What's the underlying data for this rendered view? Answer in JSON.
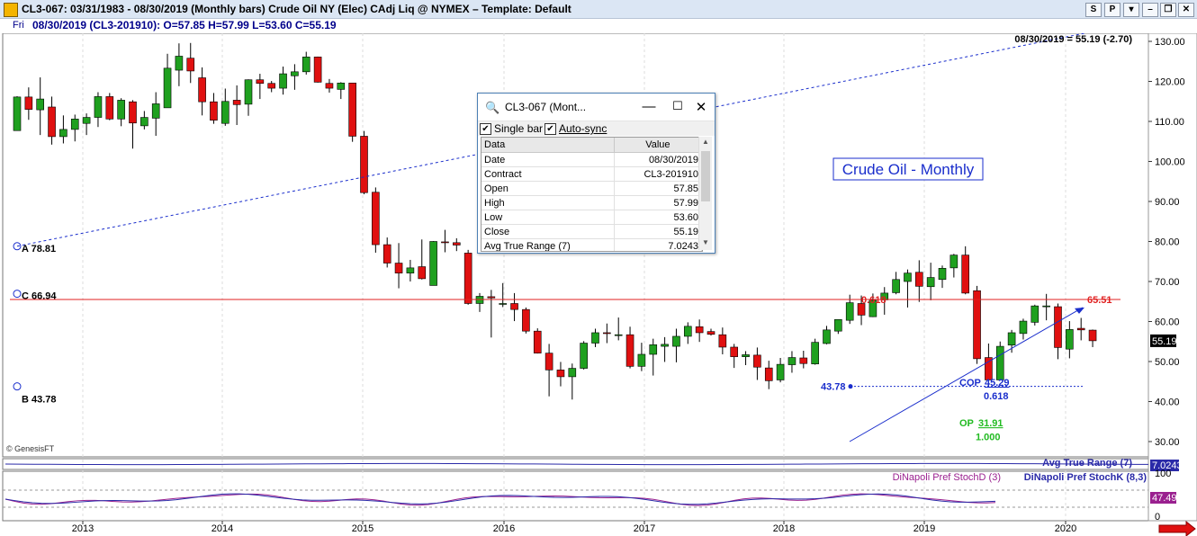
{
  "window": {
    "title": "CL3-067:  03/31/1983 - 08/30/2019  (Monthly bars)   Crude Oil NY (Elec) CAdj Liq @ NYMEX  –  Template: Default",
    "buttons": [
      "S",
      "P",
      "▾",
      "–",
      "❐",
      "✕"
    ]
  },
  "info": {
    "day": "Fri",
    "ohlc": "08/30/2019 (CL3-201910):  O=57.85  H=57.99  L=53.60  C=55.19"
  },
  "chart_data": {
    "type": "candlestick",
    "title": "Crude Oil - Monthly",
    "corner_note": "08/30/2019 = 55.19 (-2.70)",
    "copyright": "© GenesisFT",
    "yaxis": {
      "ticks": [
        "130.00",
        "120.00",
        "110.00",
        "100.00",
        "90.00",
        "80.00",
        "70.00",
        "60.00",
        "50.00",
        "40.00",
        "30.00"
      ],
      "ylim": [
        27,
        132
      ]
    },
    "xaxis": {
      "ticks": [
        "2013",
        "2014",
        "2015",
        "2016",
        "2017",
        "2018",
        "2019",
        "2020"
      ]
    },
    "last_price": "55.19",
    "bars": [
      {
        "o": 107.7,
        "h": 116.3,
        "l": 108.1,
        "c": 116.1
      },
      {
        "o": 116.1,
        "h": 118.5,
        "l": 110.4,
        "c": 113.0
      },
      {
        "o": 112.9,
        "h": 121.0,
        "l": 106.6,
        "c": 115.6
      },
      {
        "o": 113.6,
        "h": 116.2,
        "l": 104.2,
        "c": 106.2
      },
      {
        "o": 106.2,
        "h": 111.5,
        "l": 104.5,
        "c": 108.0
      },
      {
        "o": 108.0,
        "h": 111.7,
        "l": 105.0,
        "c": 110.6
      },
      {
        "o": 109.5,
        "h": 112.0,
        "l": 106.6,
        "c": 111.0
      },
      {
        "o": 111.0,
        "h": 117.3,
        "l": 108.6,
        "c": 116.2
      },
      {
        "o": 116.2,
        "h": 117.1,
        "l": 110.3,
        "c": 110.6
      },
      {
        "o": 110.6,
        "h": 115.8,
        "l": 108.8,
        "c": 115.3
      },
      {
        "o": 114.9,
        "h": 115.3,
        "l": 103.2,
        "c": 109.6
      },
      {
        "o": 108.9,
        "h": 112.6,
        "l": 108.0,
        "c": 111.0
      },
      {
        "o": 110.8,
        "h": 117.3,
        "l": 106.4,
        "c": 114.4
      },
      {
        "o": 113.4,
        "h": 126.9,
        "l": 113.4,
        "c": 123.3
      },
      {
        "o": 122.8,
        "h": 129.5,
        "l": 118.8,
        "c": 126.3
      },
      {
        "o": 125.8,
        "h": 129.6,
        "l": 119.6,
        "c": 122.6
      },
      {
        "o": 120.9,
        "h": 123.5,
        "l": 111.5,
        "c": 114.9
      },
      {
        "o": 114.9,
        "h": 117.1,
        "l": 109.4,
        "c": 110.3
      },
      {
        "o": 109.5,
        "h": 118.2,
        "l": 108.9,
        "c": 115.0
      },
      {
        "o": 115.3,
        "h": 119.0,
        "l": 109.1,
        "c": 114.2
      },
      {
        "o": 114.3,
        "h": 120.5,
        "l": 111.4,
        "c": 120.4
      },
      {
        "o": 120.4,
        "h": 121.9,
        "l": 115.6,
        "c": 119.5
      },
      {
        "o": 119.5,
        "h": 120.1,
        "l": 117.3,
        "c": 118.3
      },
      {
        "o": 118.3,
        "h": 123.7,
        "l": 116.7,
        "c": 121.9
      },
      {
        "o": 121.4,
        "h": 124.3,
        "l": 117.9,
        "c": 122.4
      },
      {
        "o": 122.4,
        "h": 127.4,
        "l": 121.7,
        "c": 126.1
      },
      {
        "o": 126.1,
        "h": 126.2,
        "l": 119.7,
        "c": 119.8
      },
      {
        "o": 119.5,
        "h": 120.6,
        "l": 117.2,
        "c": 118.3
      },
      {
        "o": 118.0,
        "h": 119.8,
        "l": 115.6,
        "c": 119.6
      },
      {
        "o": 119.6,
        "h": 119.6,
        "l": 104.9,
        "c": 106.3
      },
      {
        "o": 106.3,
        "h": 107.6,
        "l": 91.8,
        "c": 92.2
      },
      {
        "o": 92.3,
        "h": 93.5,
        "l": 77.2,
        "c": 79.2
      },
      {
        "o": 79.2,
        "h": 81.0,
        "l": 73.5,
        "c": 74.6
      },
      {
        "o": 74.6,
        "h": 79.6,
        "l": 68.3,
        "c": 72.1
      },
      {
        "o": 72.1,
        "h": 75.4,
        "l": 70.0,
        "c": 73.4
      },
      {
        "o": 73.7,
        "h": 80.5,
        "l": 70.5,
        "c": 70.7
      },
      {
        "o": 69.0,
        "h": 80.1,
        "l": 69.4,
        "c": 80.0
      },
      {
        "o": 79.9,
        "h": 82.9,
        "l": 77.3,
        "c": 79.7
      },
      {
        "o": 79.7,
        "h": 80.8,
        "l": 77.6,
        "c": 79.1
      },
      {
        "o": 77.1,
        "h": 77.9,
        "l": 64.2,
        "c": 64.5
      },
      {
        "o": 64.5,
        "h": 67.1,
        "l": 62.4,
        "c": 66.3
      },
      {
        "o": 66.2,
        "h": 67.9,
        "l": 56.0,
        "c": 65.9
      },
      {
        "o": 64.3,
        "h": 69.6,
        "l": 63.6,
        "c": 64.5
      },
      {
        "o": 64.5,
        "h": 67.1,
        "l": 60.1,
        "c": 63.0
      },
      {
        "o": 63.0,
        "h": 63.5,
        "l": 57.0,
        "c": 57.6
      },
      {
        "o": 57.6,
        "h": 58.3,
        "l": 52.0,
        "c": 52.1
      },
      {
        "o": 52.1,
        "h": 54.4,
        "l": 41.3,
        "c": 47.9
      },
      {
        "o": 47.9,
        "h": 49.9,
        "l": 43.8,
        "c": 46.2
      },
      {
        "o": 46.2,
        "h": 49.5,
        "l": 40.5,
        "c": 48.3
      },
      {
        "o": 48.3,
        "h": 55.1,
        "l": 48.0,
        "c": 54.6
      },
      {
        "o": 54.6,
        "h": 58.2,
        "l": 53.6,
        "c": 57.2
      },
      {
        "o": 57.2,
        "h": 59.5,
        "l": 54.6,
        "c": 57.0
      },
      {
        "o": 56.6,
        "h": 61.0,
        "l": 55.3,
        "c": 56.7
      },
      {
        "o": 56.7,
        "h": 58.7,
        "l": 48.3,
        "c": 48.8
      },
      {
        "o": 48.8,
        "h": 54.7,
        "l": 47.6,
        "c": 51.8
      },
      {
        "o": 51.8,
        "h": 55.7,
        "l": 46.5,
        "c": 54.2
      },
      {
        "o": 53.8,
        "h": 56.1,
        "l": 49.9,
        "c": 54.3
      },
      {
        "o": 53.8,
        "h": 58.2,
        "l": 49.8,
        "c": 56.3
      },
      {
        "o": 56.3,
        "h": 59.8,
        "l": 54.4,
        "c": 58.8
      },
      {
        "o": 58.7,
        "h": 60.5,
        "l": 54.9,
        "c": 57.2
      },
      {
        "o": 57.5,
        "h": 58.2,
        "l": 56.5,
        "c": 56.8
      },
      {
        "o": 56.7,
        "h": 58.5,
        "l": 51.8,
        "c": 53.6
      },
      {
        "o": 53.6,
        "h": 54.4,
        "l": 48.4,
        "c": 51.2
      },
      {
        "o": 51.2,
        "h": 52.6,
        "l": 49.1,
        "c": 51.7
      },
      {
        "o": 51.6,
        "h": 53.5,
        "l": 45.4,
        "c": 48.6
      },
      {
        "o": 48.4,
        "h": 50.2,
        "l": 43.1,
        "c": 45.2
      },
      {
        "o": 45.4,
        "h": 50.9,
        "l": 44.8,
        "c": 49.3
      },
      {
        "o": 49.2,
        "h": 52.6,
        "l": 47.2,
        "c": 51.0
      },
      {
        "o": 50.9,
        "h": 52.7,
        "l": 48.3,
        "c": 49.5
      },
      {
        "o": 49.4,
        "h": 55.7,
        "l": 49.2,
        "c": 54.8
      },
      {
        "o": 54.5,
        "h": 58.9,
        "l": 54.3,
        "c": 57.9
      },
      {
        "o": 57.6,
        "h": 60.4,
        "l": 56.9,
        "c": 60.5
      },
      {
        "o": 60.3,
        "h": 66.7,
        "l": 59.4,
        "c": 64.7
      },
      {
        "o": 64.5,
        "h": 66.5,
        "l": 59.1,
        "c": 61.6
      },
      {
        "o": 61.2,
        "h": 67.0,
        "l": 61.1,
        "c": 65.3
      },
      {
        "o": 65.4,
        "h": 68.6,
        "l": 61.7,
        "c": 67.1
      },
      {
        "o": 67.2,
        "h": 72.4,
        "l": 66.8,
        "c": 70.5
      },
      {
        "o": 70.0,
        "h": 73.0,
        "l": 63.5,
        "c": 72.1
      },
      {
        "o": 72.3,
        "h": 75.3,
        "l": 64.9,
        "c": 68.8
      },
      {
        "o": 68.7,
        "h": 74.7,
        "l": 65.3,
        "c": 71.0
      },
      {
        "o": 70.5,
        "h": 74.0,
        "l": 68.4,
        "c": 73.3
      },
      {
        "o": 73.4,
        "h": 76.9,
        "l": 71.0,
        "c": 76.6
      },
      {
        "o": 76.6,
        "h": 78.8,
        "l": 66.8,
        "c": 67.1
      },
      {
        "o": 67.7,
        "h": 68.9,
        "l": 49.4,
        "c": 50.7
      },
      {
        "o": 51.0,
        "h": 54.5,
        "l": 43.8,
        "c": 45.4
      },
      {
        "o": 45.4,
        "h": 55.0,
        "l": 45.6,
        "c": 53.8
      },
      {
        "o": 54.1,
        "h": 57.9,
        "l": 52.2,
        "c": 57.2
      },
      {
        "o": 57.0,
        "h": 60.7,
        "l": 55.5,
        "c": 60.1
      },
      {
        "o": 59.8,
        "h": 64.2,
        "l": 59.0,
        "c": 63.9
      },
      {
        "o": 63.8,
        "h": 66.9,
        "l": 60.3,
        "c": 63.9
      },
      {
        "o": 63.7,
        "h": 64.5,
        "l": 50.6,
        "c": 53.5
      },
      {
        "o": 53.1,
        "h": 60.1,
        "l": 50.8,
        "c": 58.0
      },
      {
        "o": 58.3,
        "h": 60.9,
        "l": 55.3,
        "c": 57.9
      },
      {
        "o": 57.85,
        "h": 57.99,
        "l": 53.6,
        "c": 55.19
      }
    ],
    "annotations": {
      "A_label": "A 78.81",
      "A_value": 78.81,
      "C_label": "C 66.94",
      "C_value": 66.94,
      "B_label": "B 43.78",
      "B_value": 43.78,
      "B_left_label": "43.78",
      "fib_label": "0.618",
      "resistance_value": 65.51,
      "resistance_label": "65.51",
      "cop_label": "COP",
      "cop_value": 45.29,
      "cop_value_label": "45.29",
      "cop_ratio": "0.618",
      "op_label": "OP",
      "op_value_label": "31.91",
      "op_ratio": "1.000"
    },
    "indicators": {
      "atr_label": "Avg True Range (7)",
      "atr_value": "7.0243",
      "stochd_label": "DiNapoli Pref StochD (3)",
      "stochk_label": "DiNapoli Pref StochK (8,3)",
      "stoch_value": "47.49",
      "stoch_ticks": [
        "100",
        "0"
      ]
    }
  },
  "popup": {
    "title": "CL3-067 (Mont...",
    "single_bar": "Single bar",
    "auto_sync": "Auto-sync",
    "header": [
      "Data",
      "Value"
    ],
    "rows": [
      [
        "Date",
        "08/30/2019"
      ],
      [
        "Contract",
        "CL3-201910"
      ],
      [
        "Open",
        "57.85"
      ],
      [
        "High",
        "57.99"
      ],
      [
        "Low",
        "53.60"
      ],
      [
        "Close",
        "55.19"
      ],
      [
        "Avg True Range (7)",
        "7.0243"
      ]
    ]
  },
  "colors": {
    "up": "#1fa01f",
    "down": "#e01010",
    "blue": "#1a2ecc",
    "resistance": "#e02020",
    "op": "#22bb22",
    "stochd": "#9a208f",
    "stochk": "#2a2aa8"
  }
}
